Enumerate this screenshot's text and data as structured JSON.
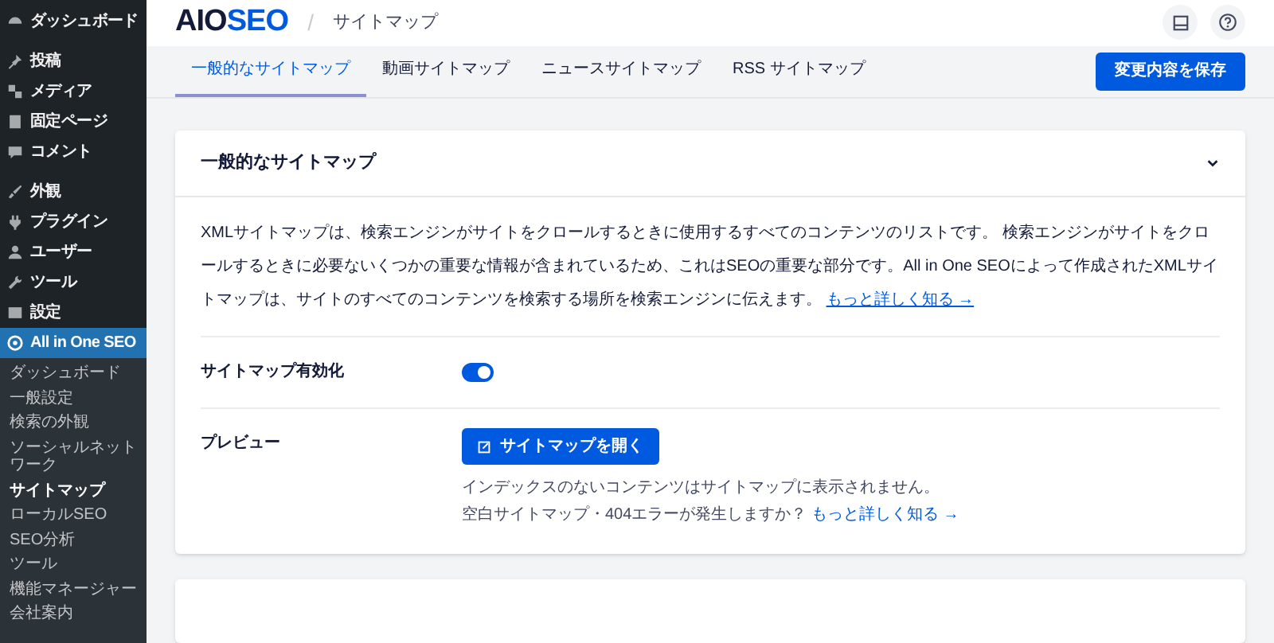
{
  "sidebar": {
    "menu_groups": [
      [
        {
          "label": "ダッシュボード",
          "selected": false
        }
      ],
      [
        {
          "label": "投稿",
          "selected": false
        },
        {
          "label": "メディア",
          "selected": false
        },
        {
          "label": "固定ページ",
          "selected": false
        },
        {
          "label": "コメント",
          "selected": false
        }
      ],
      [
        {
          "label": "外観",
          "selected": false
        },
        {
          "label": "プラグイン",
          "selected": false
        },
        {
          "label": "ユーザー",
          "selected": false
        },
        {
          "label": "ツール",
          "selected": false
        },
        {
          "label": "設定",
          "selected": false
        },
        {
          "label": "All in One SEO",
          "selected": true
        }
      ]
    ],
    "submenu": [
      {
        "label": "ダッシュボード",
        "selected": false
      },
      {
        "label": "一般設定",
        "selected": false
      },
      {
        "label": "検索の外観",
        "selected": false
      },
      {
        "label": "ソーシャルネットワーク",
        "selected": false
      },
      {
        "label": "サイトマップ",
        "selected": true
      },
      {
        "label": "ローカルSEO",
        "selected": false
      },
      {
        "label": "SEO分析",
        "selected": false
      },
      {
        "label": "ツール",
        "selected": false
      },
      {
        "label": "機能マネージャー",
        "selected": false
      },
      {
        "label": "会社案内",
        "selected": false
      }
    ]
  },
  "header": {
    "logo": {
      "dark": "AIO",
      "accent": "SEO"
    },
    "separator": "/",
    "page_title": "サイトマップ"
  },
  "tabs": [
    {
      "label": "一般的なサイトマップ",
      "selected": true
    },
    {
      "label": "動画サイトマップ",
      "selected": false
    },
    {
      "label": "ニュースサイトマップ",
      "selected": false
    },
    {
      "label": "RSS サイトマップ",
      "selected": false
    }
  ],
  "save_button": "変更内容を保存",
  "card": {
    "title": "一般的なサイトマップ",
    "expanded": true,
    "description": "XMLサイトマップは、検索エンジンがサイトをクロールするときに使用するすべてのコンテンツのリストです。 検索エンジンがサイトをクロールするときに必要ないくつかの重要な情報が含まれているため、これはSEOの重要な部分です。All in One SEOによって作成されたXMLサイトマップは、サイトのすべてのコンテンツを検索する場所を検索エンジンに伝えます。",
    "description_link": "もっと詳しく知る →",
    "settings": [
      {
        "kind": "toggle",
        "label": "サイトマップ有効化",
        "on": true
      },
      {
        "kind": "button",
        "label": "プレビュー",
        "button": "サイトマップを開く",
        "notes": [
          {
            "text": "インデックスのないコンテンツはサイトマップに表示されません。"
          },
          {
            "text": "空白サイトマップ・404エラーが発生しますか？",
            "link": "もっと詳しく知る →"
          }
        ]
      }
    ]
  }
}
